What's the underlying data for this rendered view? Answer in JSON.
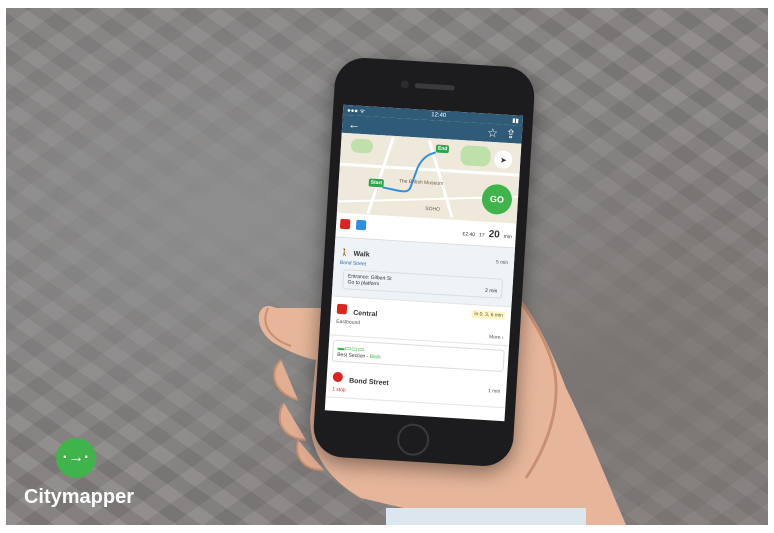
{
  "brand": {
    "name": "Citymapper",
    "icon": "arrow-right-icon",
    "color": "#3fb44a"
  },
  "phone": {
    "status_time": "12:40",
    "map": {
      "labels": [
        "The British Museum",
        "SOHO"
      ],
      "pins": [
        "Start",
        "End"
      ],
      "go_label": "GO"
    },
    "summary": {
      "price": "£2.40",
      "calories": "17",
      "duration": "20",
      "duration_unit": "min"
    },
    "steps": {
      "walk": {
        "title": "Walk",
        "subtitle": "Bond Street",
        "time": "5 min",
        "entrance": "Entrance: Gilbert St",
        "platform": "Go to platform",
        "platform_time": "2 min"
      },
      "central": {
        "title": "Central",
        "subtitle": "Eastbound",
        "departures": "in 0, 3, 6 min",
        "more": "More"
      },
      "train": {
        "best_section": "Best Section",
        "position": "Back"
      },
      "bond_street": {
        "title": "Bond Street",
        "stops": "1 stop",
        "time": "1 min"
      }
    }
  }
}
